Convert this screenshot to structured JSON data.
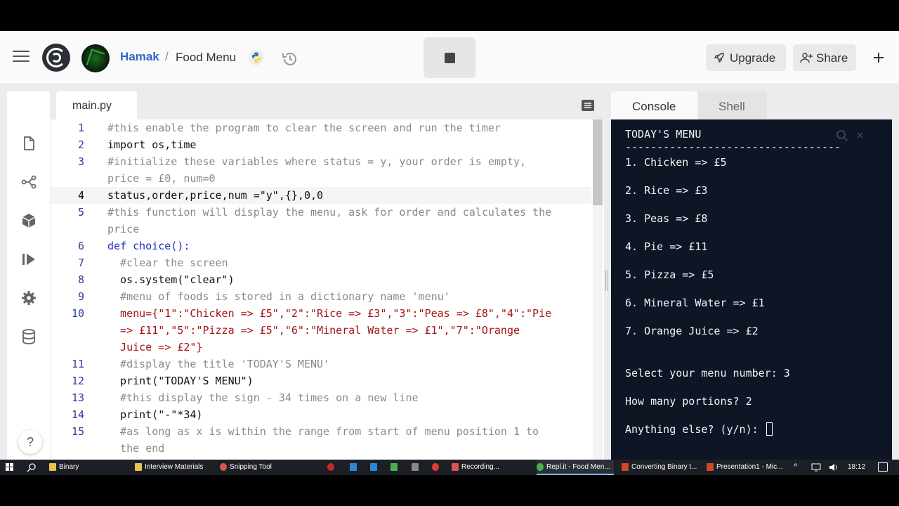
{
  "header": {
    "username": "Hamak",
    "separator": "/",
    "repl_name": "Food Menu",
    "upgrade_label": "Upgrade",
    "share_label": "Share",
    "plus_label": "+",
    "brand_color": "#3065c9"
  },
  "sidebar": {
    "icons": [
      "files-icon",
      "version-control-icon",
      "packages-icon",
      "debugger-icon",
      "settings-icon",
      "database-icon"
    ],
    "help_label": "?"
  },
  "editor": {
    "file_tab": "main.py",
    "lines": [
      {
        "num": "1",
        "text": "#this enable the program to clear the screen and run the timer"
      },
      {
        "num": "2",
        "text": "import os,time"
      },
      {
        "num": "3",
        "text": "#initialize these variables where status = y, your order is empty,"
      },
      {
        "num": "",
        "text": "price = £0, num=0"
      },
      {
        "num": "4",
        "text": "status,order,price,num =\"y\",{},0,0"
      },
      {
        "num": "5",
        "text": "#this function will display the menu, ask for order and calculates the"
      },
      {
        "num": "",
        "text": "price"
      },
      {
        "num": "6",
        "text": "def choice():"
      },
      {
        "num": "7",
        "text": "  #clear the screen"
      },
      {
        "num": "8",
        "text": "  os.system(\"clear\")"
      },
      {
        "num": "9",
        "text": "  #menu of foods is stored in a dictionary name 'menu'"
      },
      {
        "num": "10",
        "text": "  menu={\"1\":\"Chicken => £5\",\"2\":\"Rice => £3\",\"3\":\"Peas => £8\",\"4\":\"Pie"
      },
      {
        "num": "",
        "text": "  => £11\",\"5\":\"Pizza => £5\",\"6\":\"Mineral Water => £1\",\"7\":\"Orange"
      },
      {
        "num": "",
        "text": "  Juice => £2\"}"
      },
      {
        "num": "11",
        "text": "  #display the title 'TODAY'S MENU'"
      },
      {
        "num": "12",
        "text": "  print(\"TODAY'S MENU\")"
      },
      {
        "num": "13",
        "text": "  #this display the sign - 34 times on a new line"
      },
      {
        "num": "14",
        "text": "  print(\"-\"*34)"
      },
      {
        "num": "15",
        "text": "  #as long as x is within the range from start of menu position 1 to"
      },
      {
        "num": "",
        "text": "  the end"
      }
    ]
  },
  "console_tabs": {
    "console": "Console",
    "shell": "Shell"
  },
  "console": {
    "lines": [
      "TODAY'S MENU",
      "----------------------------------",
      "1. Chicken => £5",
      "2. Rice => £3",
      "3. Peas => £8",
      "4. Pie => £11",
      "5. Pizza => £5",
      "6. Mineral Water => £1",
      "7. Orange Juice => £2",
      "Select your menu number: 3",
      "How many portions? 2",
      "Anything else? (y/n): "
    ],
    "background": "#0e1525"
  },
  "taskbar": {
    "items": [
      {
        "label": "Binary",
        "color": "#e8c24a"
      },
      {
        "label": "Interview Materials",
        "color": "#e8c24a"
      },
      {
        "label": "Snipping Tool",
        "color": "#d9534f"
      },
      {
        "label": "Recording...",
        "color": "#d9534f"
      },
      {
        "label": "Repl.it - Food Men...",
        "color": "#4caf50"
      },
      {
        "label": "Converting Binary t...",
        "color": "#d24726"
      },
      {
        "label": "Presentation1 - Mic...",
        "color": "#d24726"
      }
    ],
    "clock": "18:12"
  }
}
